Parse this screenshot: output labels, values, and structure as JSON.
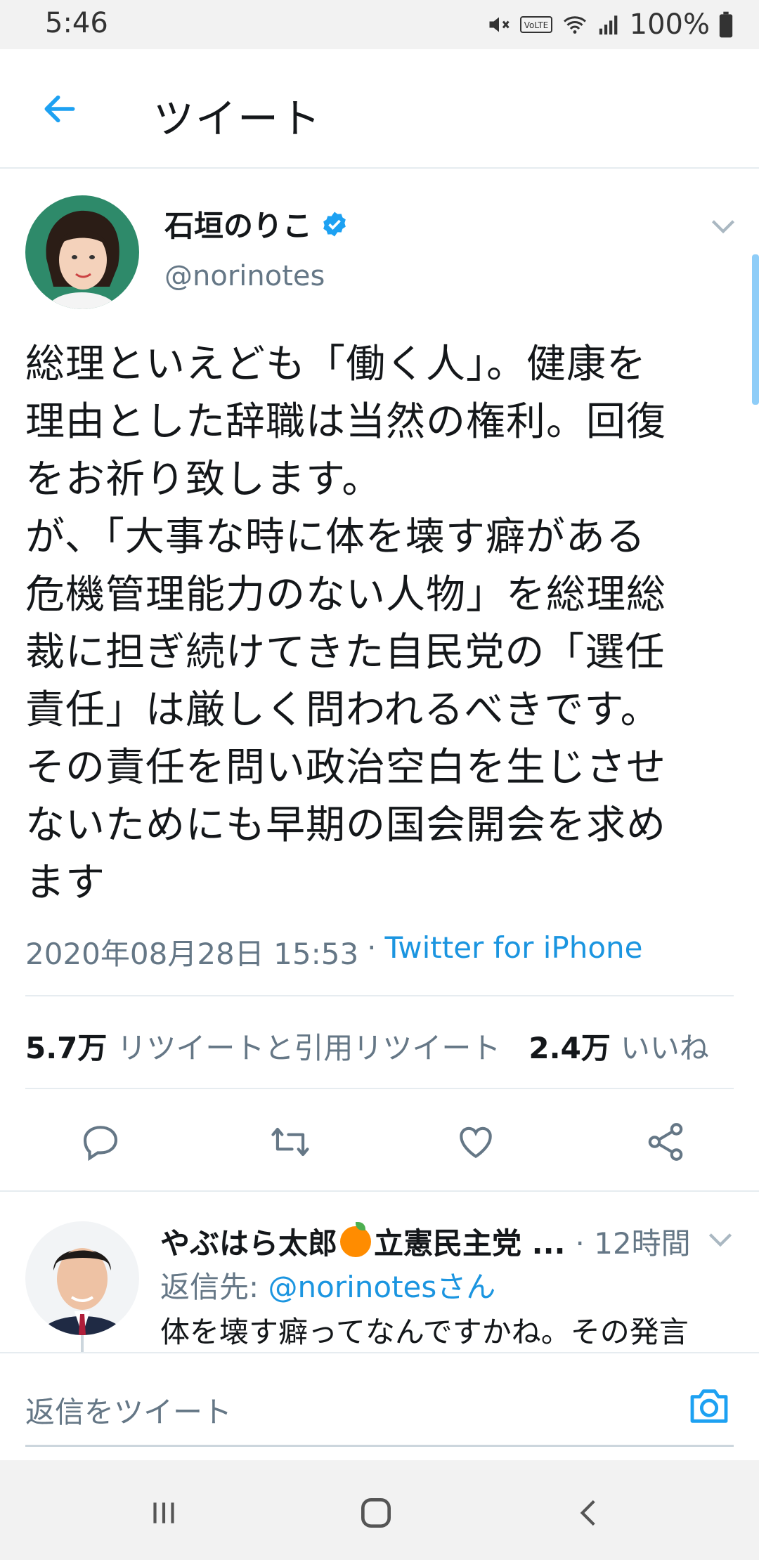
{
  "status_bar": {
    "time": "5:46",
    "battery": "100%"
  },
  "header": {
    "title": "ツイート"
  },
  "tweet": {
    "author_name": "石垣のりこ",
    "verified": true,
    "handle": "@norinotes",
    "text": "総理といえども「働く人」。健康を\n理由とした辞職は当然の権利。回復\nをお祈り致します。\nが、「大事な時に体を壊す癖がある\n危機管理能力のない人物」を総理総\n裁に担ぎ続けてきた自民党の「選任\n責任」は厳しく問われるべきです。\nその責任を問い政治空白を生じさせ\nないためにも早期の国会開会を求め\nます",
    "datetime": "2020年08月28日 15:53",
    "separator": "·",
    "source": "Twitter for iPhone",
    "retweets_count": "5.7万",
    "retweets_label": "リツイートと引用リツイート",
    "likes_count": "2.4万",
    "likes_label": "いいね"
  },
  "reply": {
    "author_name": "やぶはら太郎",
    "author_suffix": "立憲民主党 ...",
    "time": "· 12時間",
    "reply_to_prefix": "返信先: ",
    "reply_to_handle": "@norinotesさん",
    "text": "体を壊す癖ってなんですかね。その発言"
  },
  "composer": {
    "placeholder": "返信をツイート"
  },
  "colors": {
    "accent": "#1da1f2",
    "link": "#1b95e0",
    "muted": "#657786",
    "text": "#14171a"
  },
  "icons": [
    "back-arrow-icon",
    "verified-badge-icon",
    "chevron-down-icon",
    "reply-icon",
    "retweet-icon",
    "like-icon",
    "share-icon",
    "camera-icon",
    "recents-icon",
    "home-icon",
    "nav-back-icon"
  ]
}
